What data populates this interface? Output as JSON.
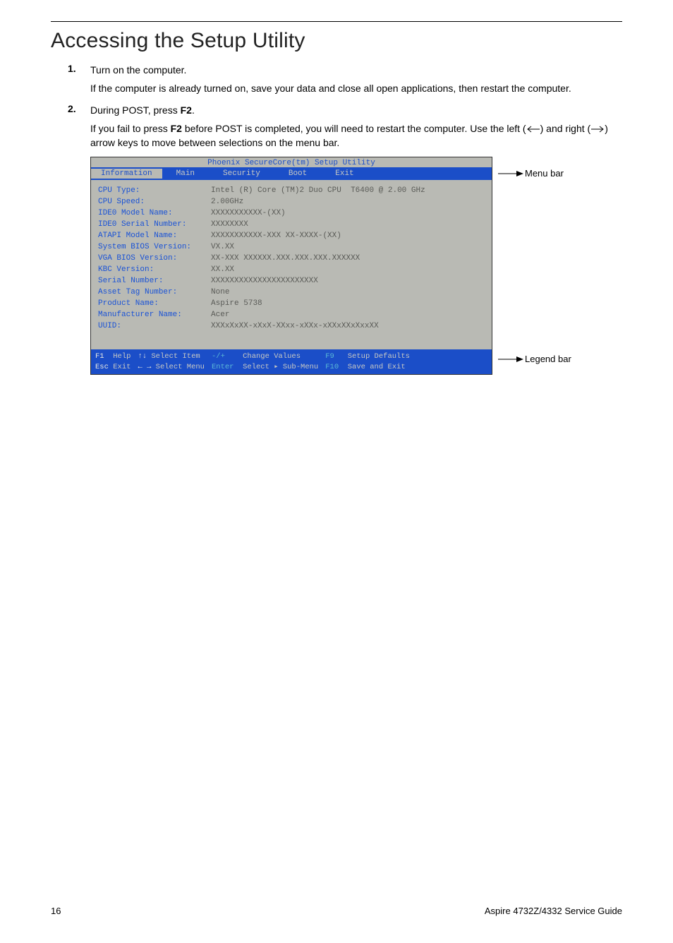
{
  "heading": "Accessing the Setup Utility",
  "steps": {
    "s1_num": "1.",
    "s1_text": "Turn on the computer.",
    "s1_sub": "If the computer is already turned on, save your data and close all open applications, then restart the computer.",
    "s2_num": "2.",
    "s2_text_a": "During POST, press ",
    "s2_text_b": "F2",
    "s2_text_c": ".",
    "s2_sub_a": "If you fail to press ",
    "s2_sub_b": "F2",
    "s2_sub_c": " before POST is completed, you will need to restart the computer. Use the left (",
    "s2_sub_d": ") and right (",
    "s2_sub_e": ") arrow keys to move between selections on the menu bar."
  },
  "bios": {
    "title": "Phoenix SecureCore(tm) Setup Utility",
    "menu": [
      "Information",
      "Main",
      "Security",
      "Boot",
      "Exit"
    ],
    "labels": "CPU Type:\nCPU Speed:\nIDE0 Model Name:\nIDE0 Serial Number:\nATAPI Model Name:\nSystem BIOS Version:\nVGA BIOS Version:\nKBC Version:\nSerial Number:\nAsset Tag Number:\nProduct Name:\nManufacturer Name:\nUUID:",
    "values": "Intel (R) Core (TM)2 Duo CPU  T6400 @ 2.00 GHz\n2.00GHz\nXXXXXXXXXXX-(XX)\nXXXXXXXX\nXXXXXXXXXXX-XXX XX-XXXX-(XX)\nVX.XX\nXX-XXX XXXXXX.XXX.XXX.XXX.XXXXXX\nXX.XX\nXXXXXXXXXXXXXXXXXXXXXXX\nNone\nAspire 5738\nAcer\nXXXxXxXX-xXxX-XXxx-xXXx-xXXxXXxXxxXX",
    "legend": {
      "f1": "F1",
      "help": "Help",
      "esc": "Esc",
      "exit": "Exit",
      "updown": "↑↓",
      "select_item": "Select Item",
      "leftright": "← →",
      "select_menu": "Select Menu",
      "pm": "-/+",
      "change_values": "Change Values",
      "enter": "Enter",
      "select_sub": "Select  ▸ Sub-Menu",
      "f9": "F9",
      "setup_defaults": "Setup Defaults",
      "f10": "F10",
      "save_exit": "Save and Exit"
    }
  },
  "callouts": {
    "menu": "Menu bar",
    "legend": "Legend bar"
  },
  "footer": {
    "page": "16",
    "title": "Aspire 4732Z/4332 Service Guide"
  }
}
